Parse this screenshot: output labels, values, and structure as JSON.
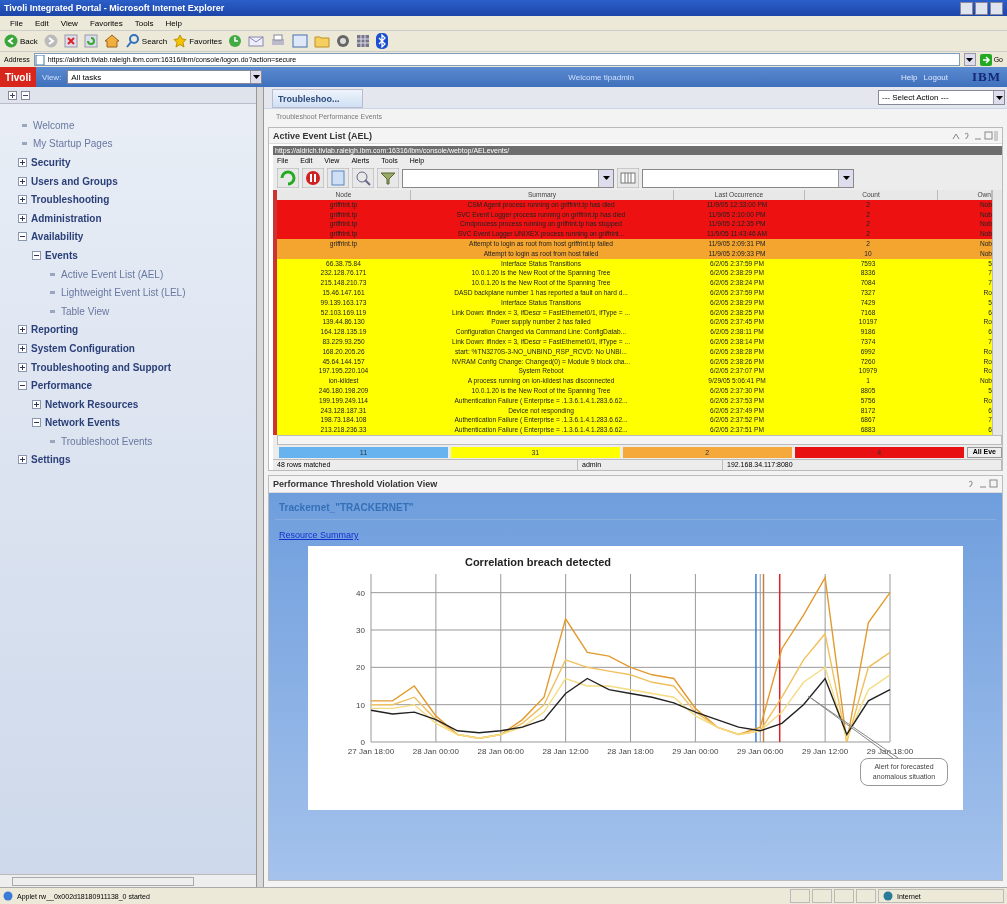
{
  "window": {
    "title": "Tivoli Integrated Portal - Microsoft Internet Explorer"
  },
  "menu": [
    "File",
    "Edit",
    "View",
    "Favorites",
    "Tools",
    "Help"
  ],
  "toolbar": {
    "back": "Back",
    "search": "Search",
    "favorites": "Favorites"
  },
  "address": {
    "label": "Address",
    "value": "https://aldrich.tivlab.raleigh.ibm.com:16316/ibm/console/logon.do?action=secure",
    "go": "Go"
  },
  "portal": {
    "logo": "Tivoli",
    "view_label": "View:",
    "view_value": "All tasks",
    "welcome": "Welcome tipadmin",
    "help": "Help",
    "logout": "Logout",
    "brand": "IBM"
  },
  "sidebar": {
    "items": [
      {
        "label": "Welcome",
        "kind": "leaf"
      },
      {
        "label": "My Startup Pages",
        "kind": "leaf"
      },
      {
        "label": "Security",
        "kind": "folder",
        "expanded": false
      },
      {
        "label": "Users and Groups",
        "kind": "folder",
        "expanded": false
      },
      {
        "label": "Troubleshooting",
        "kind": "folder",
        "expanded": false
      },
      {
        "label": "Administration",
        "kind": "folder",
        "expanded": false
      },
      {
        "label": "Availability",
        "kind": "folder",
        "expanded": true,
        "children": [
          {
            "label": "Events",
            "kind": "folder",
            "expanded": true,
            "children": [
              {
                "label": "Active Event List (AEL)",
                "kind": "leaf"
              },
              {
                "label": "Lightweight Event List (LEL)",
                "kind": "leaf"
              },
              {
                "label": "Table View",
                "kind": "leaf"
              }
            ]
          }
        ]
      },
      {
        "label": "Reporting",
        "kind": "folder",
        "expanded": false
      },
      {
        "label": "System Configuration",
        "kind": "folder",
        "expanded": false
      },
      {
        "label": "Troubleshooting and Support",
        "kind": "folder",
        "expanded": false
      },
      {
        "label": "Performance",
        "kind": "folder",
        "expanded": true,
        "children": [
          {
            "label": "Network Resources",
            "kind": "folder",
            "expanded": false
          },
          {
            "label": "Network Events",
            "kind": "folder",
            "expanded": true,
            "children": [
              {
                "label": "Troubleshoot Events",
                "kind": "leaf"
              }
            ]
          }
        ]
      },
      {
        "label": "Settings",
        "kind": "folder",
        "expanded": false
      }
    ]
  },
  "tabs": [
    {
      "label": "Troubleshoo...",
      "selected": true
    }
  ],
  "select_action": "--- Select Action ---",
  "breadcrumb": "Troubleshoot Performance Events",
  "ael": {
    "title": "Active Event List (AEL)",
    "url": "https://aldrich.tivlab.raleigh.ibm.com:16316/ibm/console/webtop/AELevents/",
    "menu": [
      "File",
      "Edit",
      "View",
      "Alerts",
      "Tools",
      "Help"
    ],
    "columns": [
      "Node",
      "Summary",
      "Last Occurrence",
      "Count",
      "Own"
    ],
    "rows": [
      {
        "color": "#ee1111",
        "cells": [
          "griffrint.tp",
          "CSM Agent process running on griffrint.tp has died",
          "11/9/05 12:33:00 PM",
          "2",
          "Nob"
        ]
      },
      {
        "color": "#ee1111",
        "cells": [
          "griffrint.tp",
          "SVC Event Logger process running on griffrint.tp has died",
          "11/9/05 2:10:00 PM",
          "2",
          "Nob"
        ]
      },
      {
        "color": "#ee1111",
        "cells": [
          "griffrint.tp",
          "Cmdprocess process running on griffrint.tp has stopped",
          "11/9/05 2:12:35 PM",
          "2",
          "Nob"
        ]
      },
      {
        "color": "#ee1111",
        "cells": [
          "griffrint.tp",
          "SVC Event Logger UNIXEX process running on griffrint...",
          "11/9/05 11:43:46 AM",
          "2",
          "Nob"
        ]
      },
      {
        "color": "#f4a530",
        "cells": [
          "griffrint.tp",
          "Attempt to login as root from host griffrint.tp failed",
          "11/9/05 2:09:31 PM",
          "2",
          "Nob"
        ]
      },
      {
        "color": "#f4a530",
        "cells": [
          "",
          "Attempt to login as root from host failed",
          "11/9/05 2:09:33 PM",
          "10",
          "Nob"
        ]
      },
      {
        "color": "#ffff00",
        "cells": [
          "66.38.75.84",
          "Interface Status Transitions",
          "6/2/05 2:37:59 PM",
          "7593",
          "5"
        ]
      },
      {
        "color": "#ffff00",
        "cells": [
          "232.128.76.171",
          "10.0.1.20 is the New Root of the Spanning Tree",
          "6/2/05 2:38:29 PM",
          "8336",
          "7"
        ]
      },
      {
        "color": "#ffff00",
        "cells": [
          "215.148.210.73",
          "10.0.1.20 is the New Root of the Spanning Tree",
          "6/2/05 2:38:24 PM",
          "7084",
          "7"
        ]
      },
      {
        "color": "#ffff00",
        "cells": [
          "15.46.147.161",
          "DASD backplane number 1 has reported a fault on hard d...",
          "6/2/05 2:37:59 PM",
          "7327",
          "Ro"
        ]
      },
      {
        "color": "#ffff00",
        "cells": [
          "99.139.163.173",
          "Interface Status Transitions",
          "6/2/05 2:38:29 PM",
          "7429",
          "5"
        ]
      },
      {
        "color": "#ffff00",
        "cells": [
          "52.103.169.119",
          "Link Down: ifIndex = 3, ifDescr = FastEthernet0/1, ifType = ...",
          "6/2/05 2:38:25 PM",
          "7168",
          "6"
        ]
      },
      {
        "color": "#ffff00",
        "cells": [
          "139.44.86.130",
          "Power supply number 2 has failed",
          "6/2/05 2:37:45 PM",
          "10197",
          "Ro"
        ]
      },
      {
        "color": "#ffff00",
        "cells": [
          "164.128.135.19",
          "Configuration Changed via Command Line: ConfigDatab...",
          "6/2/05 2:38:11 PM",
          "9186",
          "6"
        ]
      },
      {
        "color": "#ffff00",
        "cells": [
          "83.229.93.250",
          "Link Down: ifIndex = 3, ifDescr = FastEthernet0/1, ifType = ...",
          "6/2/05 2:38:14 PM",
          "7374",
          "7"
        ]
      },
      {
        "color": "#ffff00",
        "cells": [
          "168.20.205.26",
          "start: %TN3270S-3-NO_UNBIND_RSP_RCVD: No UNBI...",
          "6/2/05 2:38:28 PM",
          "6992",
          "Ro"
        ]
      },
      {
        "color": "#ffff00",
        "cells": [
          "45.64.144.157",
          "NVRAM Config Change: Changed(0) = Module 9 block cha...",
          "6/2/05 2:38:26 PM",
          "7260",
          "Ro"
        ]
      },
      {
        "color": "#ffff00",
        "cells": [
          "197.195.220.104",
          "System Reboot",
          "6/2/05 2:37:07 PM",
          "10979",
          "Ro"
        ]
      },
      {
        "color": "#ffff00",
        "cells": [
          "ion-kildest",
          "A process running on ion-kildest has disconnected",
          "9/29/05 5:06:41 PM",
          "1",
          "Nob"
        ]
      },
      {
        "color": "#ffff00",
        "cells": [
          "246.180.198.209",
          "10.0.1.20 is the New Root of the Spanning Tree",
          "6/2/05 2:37:30 PM",
          "8805",
          "5"
        ]
      },
      {
        "color": "#ffff00",
        "cells": [
          "199.199.249.114",
          "Authentication Failure ( Enterprise = .1.3.6.1.4.1.283.6.62...",
          "6/2/05 2:37:53 PM",
          "5756",
          "Ro"
        ]
      },
      {
        "color": "#ffff00",
        "cells": [
          "243.128.187.31",
          "Device not responding",
          "6/2/05 2:37:49 PM",
          "8172",
          "6"
        ]
      },
      {
        "color": "#ffff00",
        "cells": [
          "198.73.184.108",
          "Authentication Failure ( Enterprise = .1.3.6.1.4.1.283.6.62...",
          "6/2/05 2:37:52 PM",
          "6867",
          "7"
        ]
      },
      {
        "color": "#ffff00",
        "cells": [
          "213.218.236.33",
          "Authentication Failure ( Enterprise = .1.3.6.1.4.1.283.6.62...",
          "6/2/05 2:37:51 PM",
          "6883",
          "6"
        ]
      }
    ],
    "summary": [
      {
        "count": "11",
        "color": "#66b3f0"
      },
      {
        "count": "31",
        "color": "#ffff00"
      },
      {
        "count": "2",
        "color": "#f4a93a"
      },
      {
        "count": "4",
        "color": "#e81010"
      }
    ],
    "all_events": "All Eve",
    "status": [
      "48 rows matched",
      "admin",
      "192.168.34.117:8080"
    ]
  },
  "ptv": {
    "title": "Performance Threshold Violation View",
    "heading": "Trackernet_\"TRACKERNET\"",
    "link": "Resource Summary",
    "chart_data": {
      "type": "line",
      "title": "Correlation breach detected",
      "categories": [
        "27 Jan 18:00",
        null,
        null,
        "28 Jan 00:00",
        null,
        null,
        "28 Jan 06:00",
        null,
        null,
        "28 Jan 12:00",
        null,
        null,
        "28 Jan 18:00",
        null,
        null,
        "29 Jan 00:00",
        null,
        null,
        "29 Jan 06:00",
        null,
        null,
        "29 Jan 12:00",
        null,
        null,
        "29 Jan 18:00"
      ],
      "yticks": [
        0,
        10,
        20,
        30,
        40
      ],
      "ylim": [
        0,
        45
      ],
      "grid": true,
      "series": [
        {
          "color": "#e39a2e",
          "values": [
            11,
            11,
            15,
            7,
            2,
            1,
            2,
            6,
            12,
            33,
            24,
            23,
            20,
            18,
            17,
            9,
            4,
            2,
            4,
            25,
            34,
            44,
            0,
            32,
            40
          ]
        },
        {
          "color": "#f0c060",
          "values": [
            10,
            10,
            12,
            6,
            2,
            1,
            2,
            5,
            10,
            22,
            20,
            19,
            18,
            16,
            15,
            8,
            4,
            2,
            3,
            12,
            22,
            29,
            0,
            20,
            24
          ]
        },
        {
          "color": "#f5dc80",
          "values": [
            9,
            9,
            10,
            5,
            2,
            1,
            2,
            4,
            8,
            17,
            15,
            15,
            14,
            13,
            12,
            7,
            4,
            2,
            3,
            8,
            16,
            20,
            1,
            14,
            18
          ]
        },
        {
          "color": "#222222",
          "values": [
            8.5,
            7.5,
            8,
            6,
            3,
            2.5,
            3,
            4,
            6,
            13,
            17,
            14,
            13,
            12,
            10.5,
            8,
            6,
            4,
            3,
            5,
            10,
            17,
            2,
            11,
            14
          ]
        }
      ],
      "annotations": [
        "Alert for forecasted anomalous situation"
      ]
    }
  },
  "status_bar": {
    "text": "Applet rw__0x002d18180911138_0 started",
    "zone": "Internet"
  }
}
